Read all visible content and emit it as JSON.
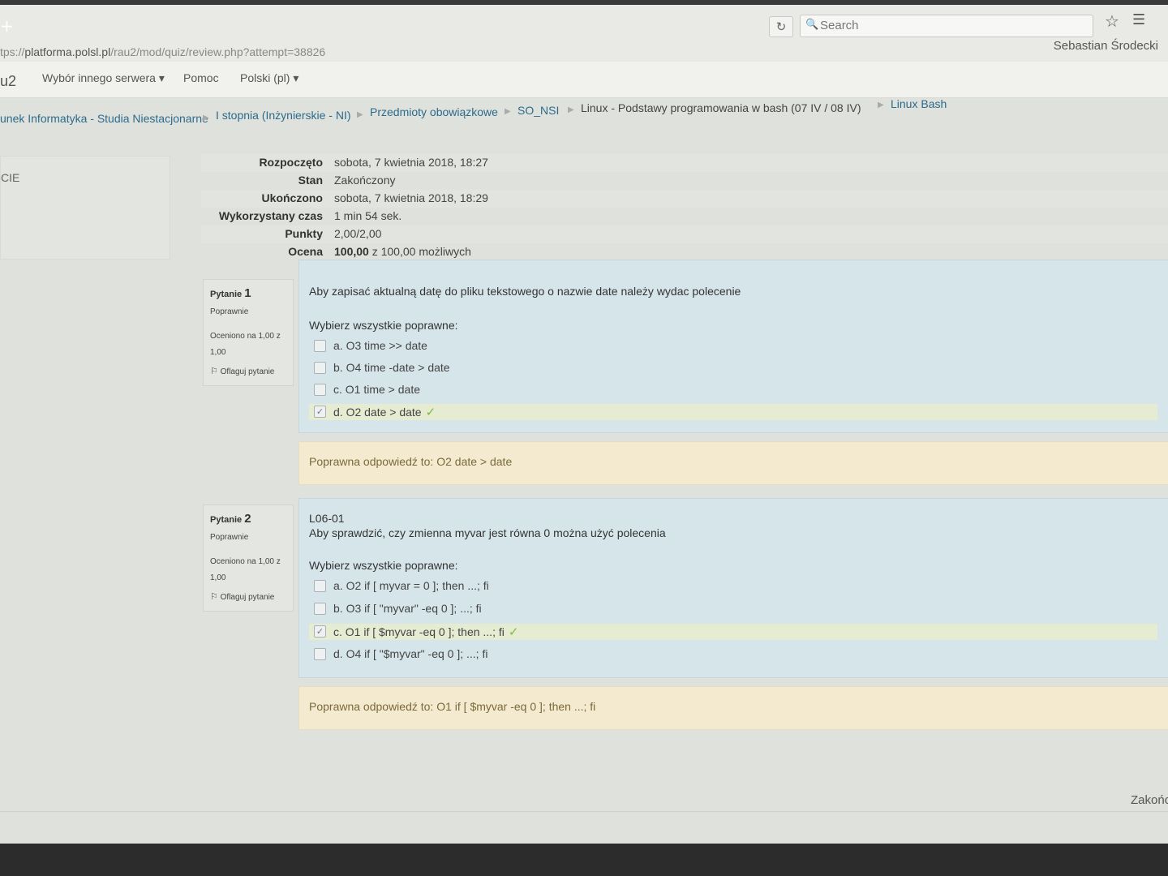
{
  "browser": {
    "new_tab": "+",
    "url_prefix": "tps://",
    "url_domain": "platforma.polsl.pl",
    "url_path": "/rau2/mod/quiz/review.php?attempt=38826",
    "search_placeholder": "Search",
    "refresh_icon": "refresh-icon",
    "star_icon": "star-icon"
  },
  "navbar": {
    "brand": "u2",
    "server": "Wybór innego serwera ▾",
    "help": "Pomoc",
    "language": "Polski (pl) ▾",
    "user": "Sebastian Środecki"
  },
  "breadcrumb": [
    "unek Informatyka - Studia Niestacjonarne",
    "I stopnia (Inżynierskie - NI)",
    "Przedmioty obowiązkowe",
    "SO_NSI",
    "Linux - Podstawy programowania w bash (07 IV / 08 IV)",
    "Linux Bash"
  ],
  "sidebar": {
    "label": "CIE"
  },
  "summary": {
    "rows": [
      {
        "label": "Rozpoczęto",
        "value": "sobota, 7 kwietnia 2018, 18:27"
      },
      {
        "label": "Stan",
        "value": "Zakończony"
      },
      {
        "label": "Ukończono",
        "value": "sobota, 7 kwietnia 2018, 18:29"
      },
      {
        "label": "Wykorzystany czas",
        "value": "1 min 54 sek."
      },
      {
        "label": "Punkty",
        "value": "2,00/2,00"
      }
    ],
    "grade_label": "Ocena",
    "grade_bold": "100,00",
    "grade_rest": " z 100,00 możliwych"
  },
  "questions": [
    {
      "label": "Pytanie",
      "number": "1",
      "state": "Poprawnie",
      "grade": "Oceniono na 1,00 z 1,00",
      "flag": "Oflaguj pytanie",
      "code": "",
      "text": "Aby zapisać aktualną datę do pliku tekstowego o nazwie date należy wydac polecenie",
      "prompt": "Wybierz wszystkie poprawne:",
      "options": [
        {
          "label": "a. O3 time >> date",
          "checked": false,
          "correct": false
        },
        {
          "label": "b. O4 time -date > date",
          "checked": false,
          "correct": false
        },
        {
          "label": "c. O1 time > date",
          "checked": false,
          "correct": false
        },
        {
          "label": "d. O2 date > date",
          "checked": true,
          "correct": true
        }
      ],
      "feedback": "Poprawna odpowiedź to: O2 date > date"
    },
    {
      "label": "Pytanie",
      "number": "2",
      "state": "Poprawnie",
      "grade": "Oceniono na 1,00 z 1,00",
      "flag": "Oflaguj pytanie",
      "code": "L06-01",
      "text": "Aby sprawdzić, czy zmienna myvar jest równa 0 można użyć polecenia",
      "prompt": "Wybierz wszystkie poprawne:",
      "options": [
        {
          "label": "a. O2 if [ myvar = 0 ]; then ...; fi",
          "checked": false,
          "correct": false
        },
        {
          "label": "b. O3 if [ \"myvar\" -eq 0 ]; ...; fi",
          "checked": false,
          "correct": false
        },
        {
          "label": "c. O1 if [ $myvar -eq 0 ]; then ...; fi",
          "checked": true,
          "correct": true
        },
        {
          "label": "d. O4 if [ \"$myvar\" -eq 0 ]; ...; fi",
          "checked": false,
          "correct": false
        }
      ],
      "feedback": "Poprawna odpowiedź to: O1 if [ $myvar -eq 0 ]; then ...; fi"
    }
  ],
  "footer": {
    "finish": "Zakończ"
  }
}
